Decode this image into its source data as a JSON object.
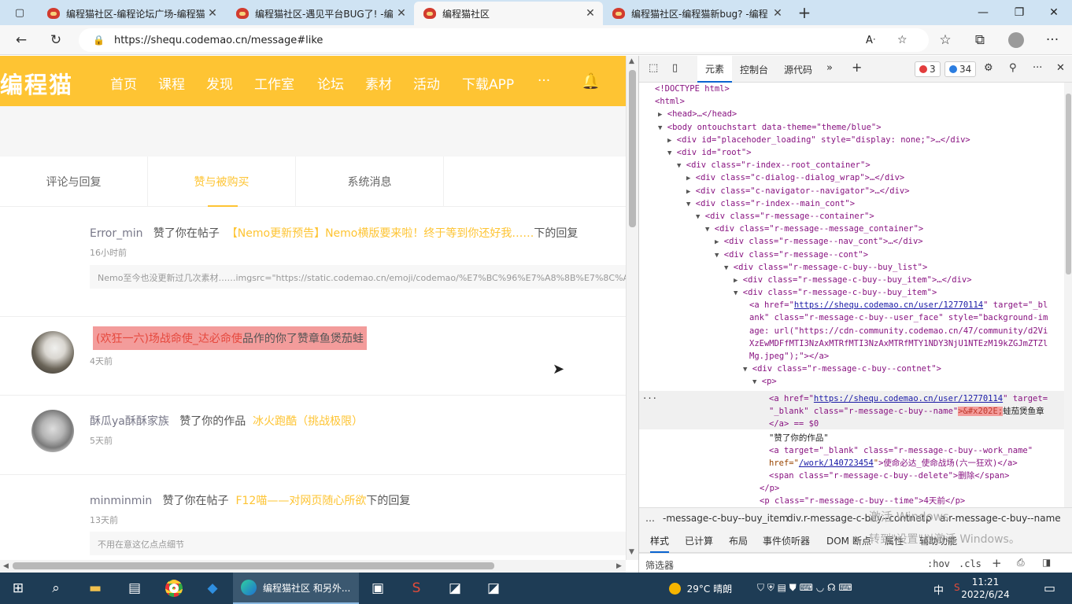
{
  "tabs": [
    {
      "title": "编程猫社区-编程论坛广场-编程猫"
    },
    {
      "title": "编程猫社区-遇见平台BUG了! -编"
    },
    {
      "title": "编程猫社区"
    },
    {
      "title": "编程猫社区-编程猫新bug? -编程"
    }
  ],
  "browser": {
    "url": "https://shequ.codemao.cn/message#like"
  },
  "site": {
    "logo": "编程猫",
    "nav": [
      "首页",
      "课程",
      "发现",
      "工作室",
      "论坛",
      "素材",
      "活动",
      "下载APP",
      "···"
    ]
  },
  "message_tabs": [
    "评论与回复",
    "赞与被购买",
    "系统消息"
  ],
  "messages": [
    {
      "user": "Error_min",
      "action": "赞了你在帖子",
      "target": "【Nemo更新预告】Nemo横版要来啦！终于等到你还好我……",
      "suffix": "下的回复",
      "time": "16小时前",
      "quote": "Nemo至今也没更新过几次素材……imgsrc=\"https://static.codemao.cn/emoji/codemao/%E7%BC%96%E7%A8%8B%E7%8C%AB%E5"
    },
    {
      "hl_red": "(欢狂一六)场战命使_达必命使",
      "hl_text": "品作的你了赞章鱼煲茄蛙",
      "time": "4天前"
    },
    {
      "user": "酥瓜ya酥酥家族",
      "action": "赞了你的作品",
      "target": "冰火跑酷（挑战极限）",
      "time": "5天前"
    },
    {
      "user": "minminmin",
      "action": "赞了你在帖子",
      "target": "F12喵——对网页随心所欲",
      "suffix": "下的回复",
      "time": "13天前",
      "quote": "不用在意这亿点点细节"
    }
  ],
  "devtools": {
    "tabs": [
      "元素",
      "控制台",
      "源代码"
    ],
    "errors": "3",
    "messages": "34",
    "code": {
      "doctype": "<!DOCTYPE html>",
      "html": "<html>",
      "head": "<head>…</head>",
      "body": "<body ontouchstart data-theme=\"theme/blue\">",
      "placeholder": "<div id=\"placehoder_loading\" style=\"display: none;\">…</div>",
      "root": "<div id=\"root\">",
      "root_container": "<div class=\"r-index--root_container\">",
      "dialog": "<div class=\"c-dialog--dialog_wrap\">…</div>",
      "navigator": "<div class=\"c-navigator--navigator\">…</div>",
      "main_cont": "<div class=\"r-index--main_cont\">",
      "msg_container": "<div class=\"r-message--container\">",
      "msg_message_container": "<div class=\"r-message--message_container\">",
      "nav_cont": "<div class=\"r-message--nav_cont\">…</div>",
      "cont": "<div class=\"r-message--cont\">",
      "buy_list": "<div class=\"r-message-c-buy--buy_list\">",
      "buy_item1": "<div class=\"r-message-c-buy--buy_item\">…</div>",
      "buy_item2": "<div class=\"r-message-c-buy--buy_item\">",
      "a_href": "https://shequ.codemao.cn/user/12770114",
      "a_line1_tail": " target=\"_bl",
      "a_line2": "ank\" class=\"r-message-c-buy--user_face\" style=\"background-im",
      "a_line3": "age: url(\"https://cdn-community.codemao.cn/47/community/d2Vi",
      "a_line4": "XzEwMDFfMTI3NzAxMTRfMTI3NzAxMTRfMTY1NDY3NjU1NTEzM19kZGJmZTZl",
      "a_line5": "Mg.jpeg\");\"></a>",
      "contnet": "<div class=\"r-message-c-buy--contnet\">",
      "p": "<p>",
      "sel_href": "https://shequ.codemao.cn/user/12770114",
      "sel_tail": " target=",
      "sel_line2a": "\"_blank\" class=\"r-message-c-buy--name\"",
      "sel_entity": ">&#x202E;",
      "sel_text": "蛙茄煲鱼章",
      "sel_line3": "</a> == $0",
      "text_node": "\"赞了你的作品\"",
      "work_a1": "<a target=\"_blank\" class=\"r-message-c-buy--work_name\"",
      "work_href": "/work/140723454",
      "work_text": ">使命必达_使命战场(六一狂欢)</a>",
      "span_delete": "<span class=\"r-message-c-buy--delete\">删除</span>",
      "p_close": "</p>",
      "p_time": "<p class=\"r-message-c-buy--time\">4天前</p>"
    },
    "breadcrumbs": [
      "…",
      "-message-c-buy--buy_item",
      "div.r-message-c-buy--contnet",
      "p",
      "a.r-message-c-buy--name"
    ],
    "styles_tabs": [
      "样式",
      "已计算",
      "布局",
      "事件侦听器",
      "DOM 断点",
      "属性",
      "辅助功能"
    ],
    "filter": "筛选器",
    "hov": ":hov",
    "cls": ".cls"
  },
  "watermark": {
    "line1": "激活 Windows",
    "line2": "转到\"设置\"以激活 Windows。"
  },
  "taskbar": {
    "app": "编程猫社区 和另外...",
    "weather": "29°C 晴朗",
    "time": "11:21",
    "date": "2022/6/24",
    "ime": "中"
  }
}
